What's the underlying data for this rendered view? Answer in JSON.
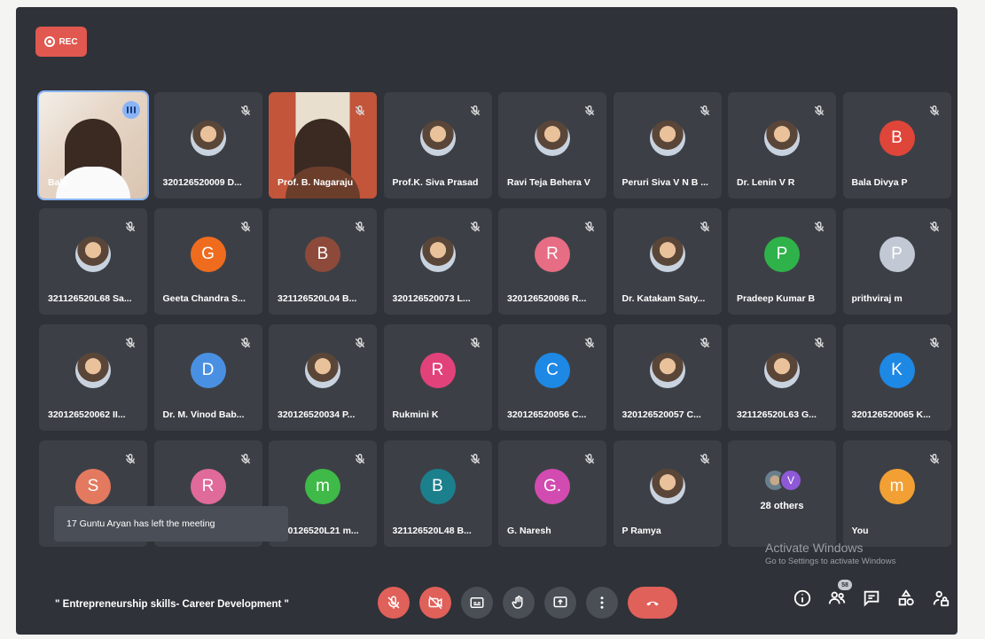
{
  "recording": {
    "label": "REC"
  },
  "participants": [
    {
      "name": "Bala",
      "kind": "video-1",
      "muted": false,
      "speaking": true
    },
    {
      "name": "320126520009 D...",
      "kind": "photo",
      "muted": true
    },
    {
      "name": "Prof. B. Nagaraju",
      "kind": "video-2",
      "muted": true
    },
    {
      "name": "Prof.K. Siva Prasad",
      "kind": "photo",
      "muted": true
    },
    {
      "name": "Ravi Teja Behera V",
      "kind": "photo",
      "muted": true
    },
    {
      "name": "Peruri Siva V N B ...",
      "kind": "photo",
      "muted": true
    },
    {
      "name": "Dr. Lenin V R",
      "kind": "photo",
      "muted": true
    },
    {
      "name": "Bala Divya P",
      "kind": "letter",
      "initial": "B",
      "color": "#e0453a",
      "muted": true
    },
    {
      "name": "321126520L68 Sa...",
      "kind": "photo",
      "muted": true
    },
    {
      "name": "Geeta Chandra S...",
      "kind": "letter",
      "initial": "G",
      "color": "#ef6c1f",
      "muted": true
    },
    {
      "name": "321126520L04 B...",
      "kind": "letter",
      "initial": "B",
      "color": "#8d4a3a",
      "muted": true
    },
    {
      "name": "320126520073 L...",
      "kind": "photo",
      "muted": true
    },
    {
      "name": "320126520086 R...",
      "kind": "letter",
      "initial": "R",
      "color": "#e66d83",
      "muted": true
    },
    {
      "name": "Dr. Katakam Saty...",
      "kind": "photo",
      "muted": true
    },
    {
      "name": "Pradeep Kumar B",
      "kind": "letter",
      "initial": "P",
      "color": "#2fb24a",
      "muted": true
    },
    {
      "name": "prithviraj m",
      "kind": "letter",
      "initial": "P",
      "color": "#c2c8d4",
      "muted": true
    },
    {
      "name": "320126520062 II...",
      "kind": "photo",
      "muted": true
    },
    {
      "name": "Dr. M. Vinod Bab...",
      "kind": "letter",
      "initial": "D",
      "color": "#4a90e2",
      "muted": true
    },
    {
      "name": "320126520034 P...",
      "kind": "photo",
      "muted": true
    },
    {
      "name": "Rukmini K",
      "kind": "letter",
      "initial": "R",
      "color": "#e2427a",
      "muted": true
    },
    {
      "name": "320126520056 C...",
      "kind": "letter",
      "initial": "C",
      "color": "#1e88e5",
      "muted": true
    },
    {
      "name": "320126520057 C...",
      "kind": "photo",
      "muted": true
    },
    {
      "name": "321126520L63 G...",
      "kind": "photo",
      "muted": true
    },
    {
      "name": "320126520065 K...",
      "kind": "letter",
      "initial": "K",
      "color": "#1e88e5",
      "muted": true
    },
    {
      "name": "",
      "kind": "letter",
      "initial": "S",
      "color": "#e3795f",
      "muted": true
    },
    {
      "name": "",
      "kind": "letter",
      "initial": "R",
      "color": "#e06a9a",
      "muted": true
    },
    {
      "name": "320126520L21 m...",
      "kind": "letter",
      "initial": "m",
      "color": "#3fb948",
      "muted": true
    },
    {
      "name": "321126520L48 B...",
      "kind": "letter",
      "initial": "B",
      "color": "#1c7f8c",
      "muted": true
    },
    {
      "name": "G. Naresh",
      "kind": "letter",
      "initial": "G.",
      "color": "#d24bb0",
      "muted": true
    },
    {
      "name": "P Ramya",
      "kind": "photo",
      "muted": true
    },
    {
      "name": "",
      "kind": "others",
      "initial": "V",
      "muted": false,
      "others_label": "28 others"
    },
    {
      "name": "You",
      "kind": "letter",
      "initial": "m",
      "color": "#f2a033",
      "muted": true
    }
  ],
  "toast": {
    "text": "17 Guntu Aryan has left the meeting"
  },
  "watermark": {
    "title": "Activate Windows",
    "subtitle": "Go to Settings to activate Windows"
  },
  "meeting": {
    "title": "\" Entrepreneurship skills- Career Development \""
  },
  "controls": [
    "mic-off-icon",
    "camera-off-icon",
    "captions-icon",
    "raise-hand-icon",
    "present-icon",
    "more-options-icon",
    "end-call-icon"
  ],
  "right_controls": {
    "people_count": "58"
  }
}
